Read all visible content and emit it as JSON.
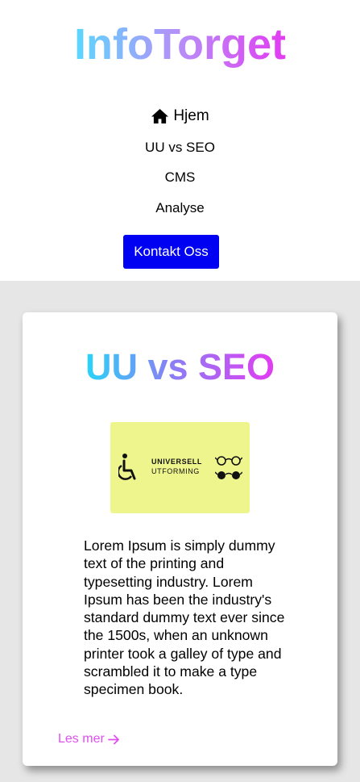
{
  "header": {
    "logo": "InfoTorget",
    "nav": [
      {
        "label": "Hjem",
        "icon": "home-icon"
      },
      {
        "label": "UU vs SEO"
      },
      {
        "label": "CMS"
      },
      {
        "label": "Analyse"
      }
    ],
    "contact_button": "Kontakt Oss"
  },
  "card": {
    "title": "UU vs SEO",
    "image": {
      "line1": "UNIVERSELL",
      "line2": "UTFORMING",
      "background": "#eff58d"
    },
    "body": "Lorem Ipsum is simply dummy text of the printing and typesetting industry. Lorem Ipsum has been the industry's standard dummy text ever since the 1500s, when an unknown printer took a galley of type and scrambled it to make a type specimen book.",
    "read_more": "Les mer",
    "read_more_icon": "arrow-right-icon"
  },
  "colors": {
    "accent_button": "#0000f2",
    "gradient_start": "#5ad8ff",
    "gradient_end": "#e23cf2",
    "main_background": "#e6e6e6",
    "link": "#e04ff0"
  }
}
